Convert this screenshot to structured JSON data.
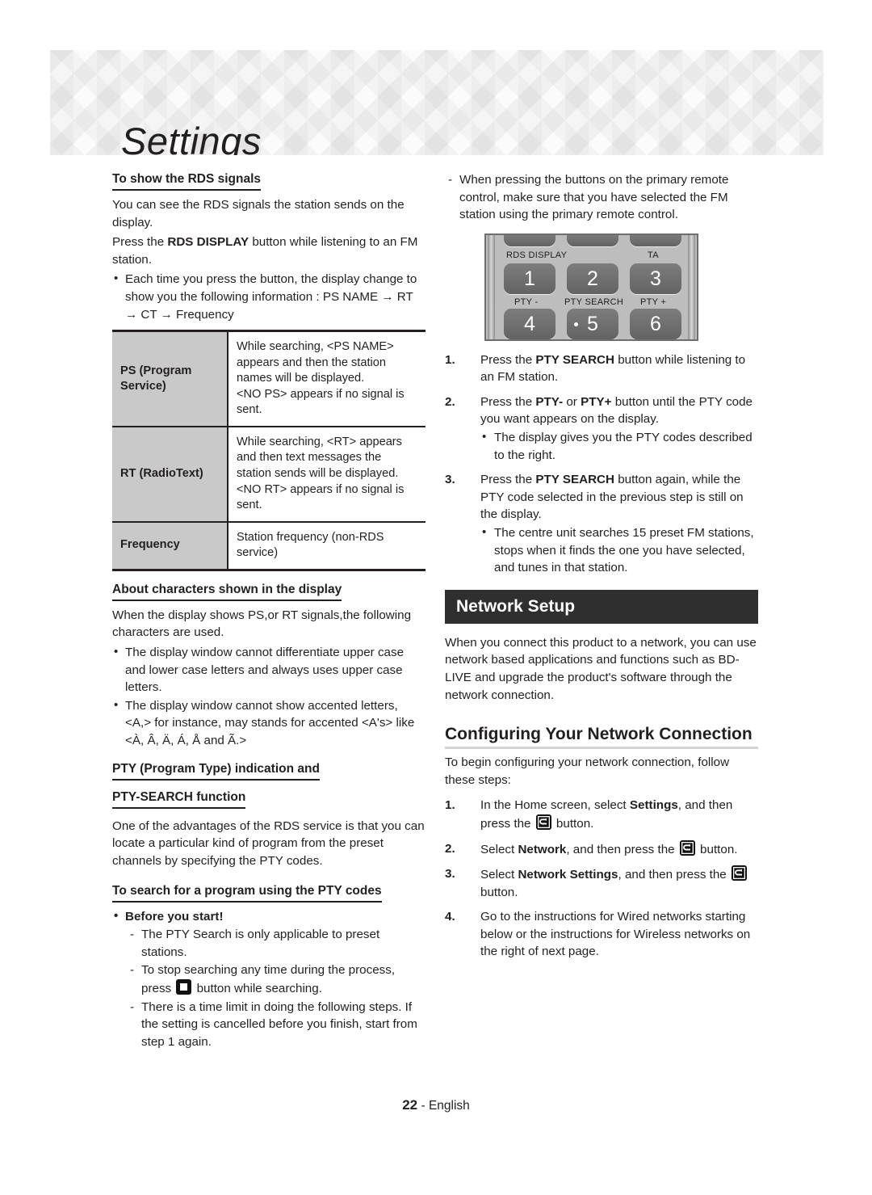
{
  "page": {
    "banner_title": "Settings",
    "footer_page_number": "22",
    "footer_separator": "-",
    "footer_language": "English"
  },
  "left_column": {
    "rds_heading": "To show the RDS signals",
    "rds_p1": "You can see the RDS signals the station sends on the display.",
    "rds_p2_before": "Press the ",
    "rds_p2_bold": "RDS DISPLAY",
    "rds_p2_after": " button while listening to an FM station.",
    "rds_bullet1": "Each time you press the button, the display change to show you the following information : PS NAME → RT → CT → Frequency",
    "table": {
      "rows": [
        {
          "key": "PS (Program Service)",
          "value": "While searching, <PS NAME> appears and then the station names will be displayed.\n<NO PS> appears if no signal is sent."
        },
        {
          "key": "RT (RadioText)",
          "value": "While searching, <RT> appears and then text messages the station sends will be displayed.\n<NO RT> appears if no signal is sent."
        },
        {
          "key": "Frequency",
          "value": "Station frequency (non-RDS service)"
        }
      ]
    },
    "chars_heading": "About characters shown in the display",
    "chars_p1": "When the display shows PS,or RT signals,the following characters are used.",
    "chars_bullet1": "The display window cannot differentiate upper case and lower case letters and always uses upper case letters.",
    "chars_bullet2": "The display window cannot show accented letters, <A,> for instance, may stands for accented <A's> like <À, Â, Ä, Á, Å and Ã.>",
    "pty_heading_line1": "PTY (Program Type) indication and",
    "pty_heading_line2": "PTY-SEARCH function",
    "pty_p1": "One of the advantages of the RDS service is that you can locate a particular kind of program from the preset channels by specifying the PTY codes.",
    "search_heading": "To search for a program using the PTY codes",
    "before_you_start": "Before you start!",
    "before_items": [
      {
        "before": "The PTY Search is only applicable to preset stations.",
        "icon": null,
        "after": ""
      },
      {
        "before": "To stop searching any time during the process, press ",
        "icon": "stop-icon",
        "after": " button while searching."
      },
      {
        "before": "There is a time limit in doing the following steps. If the setting is cancelled before you finish, start from step 1 again.",
        "icon": null,
        "after": ""
      }
    ]
  },
  "right_column": {
    "primary_remote_note": "When pressing the buttons on the primary remote control, make sure that you have selected the FM station using the primary remote control.",
    "remote": {
      "label_rds_display": "RDS DISPLAY",
      "label_ta": "TA",
      "label_pty_minus": "PTY -",
      "label_pty_search": "PTY SEARCH",
      "label_pty_plus": "PTY +",
      "key_1": "1",
      "key_2": "2",
      "key_3": "3",
      "key_4": "4",
      "key_5": "5",
      "key_6": "6"
    },
    "pty_steps": [
      {
        "num": "1.",
        "parts": [
          {
            "t": "Press the ",
            "b": false
          },
          {
            "t": "PTY SEARCH",
            "b": true
          },
          {
            "t": " button while listening to an FM station.",
            "b": false
          }
        ],
        "bullets": []
      },
      {
        "num": "2.",
        "parts": [
          {
            "t": "Press the ",
            "b": false
          },
          {
            "t": "PTY-",
            "b": true
          },
          {
            "t": " or ",
            "b": false
          },
          {
            "t": "PTY+",
            "b": true
          },
          {
            "t": " button until the PTY code you want appears on the display.",
            "b": false
          }
        ],
        "bullets": [
          "The display gives you the PTY codes described to the right."
        ]
      },
      {
        "num": "3.",
        "parts": [
          {
            "t": "Press the ",
            "b": false
          },
          {
            "t": "PTY SEARCH",
            "b": true
          },
          {
            "t": " button again, while the PTY code selected in the previous step is still on the display.",
            "b": false
          }
        ],
        "bullets": [
          "The centre unit searches 15 preset FM stations, stops when it finds the one you have selected, and tunes in that station."
        ]
      }
    ],
    "network_setup_title": "Network Setup",
    "network_setup_p1": "When you connect this product to a network, you can use network based applications and functions such as BD-LIVE and upgrade the product's software through the network connection.",
    "configuring_heading": "Configuring Your Network Connection",
    "configuring_p1": "To begin configuring your network connection, follow these steps:",
    "config_steps": [
      {
        "num": "1.",
        "pre_parts": [
          {
            "t": "In the Home screen, select ",
            "b": false
          },
          {
            "t": "Settings",
            "b": true
          },
          {
            "t": ", and then press the ",
            "b": false
          }
        ],
        "icon": "enter-icon",
        "post": " button."
      },
      {
        "num": "2.",
        "pre_parts": [
          {
            "t": "Select ",
            "b": false
          },
          {
            "t": "Network",
            "b": true
          },
          {
            "t": ", and then press the ",
            "b": false
          }
        ],
        "icon": "enter-icon",
        "post": " button."
      },
      {
        "num": "3.",
        "pre_parts": [
          {
            "t": "Select ",
            "b": false
          },
          {
            "t": "Network Settings",
            "b": true
          },
          {
            "t": ", and then press the ",
            "b": false
          }
        ],
        "icon": "enter-icon",
        "post": " button."
      },
      {
        "num": "4.",
        "pre_parts": [
          {
            "t": "Go to the instructions for Wired networks starting below or the instructions for Wireless networks on the right of next page.",
            "b": false
          }
        ],
        "icon": null,
        "post": ""
      }
    ]
  },
  "colors": {
    "text": "#231f20",
    "table_key_bg": "#c9c9c9",
    "bar_bg": "#2f2f2f",
    "rule_gray": "#d4d4d4"
  }
}
